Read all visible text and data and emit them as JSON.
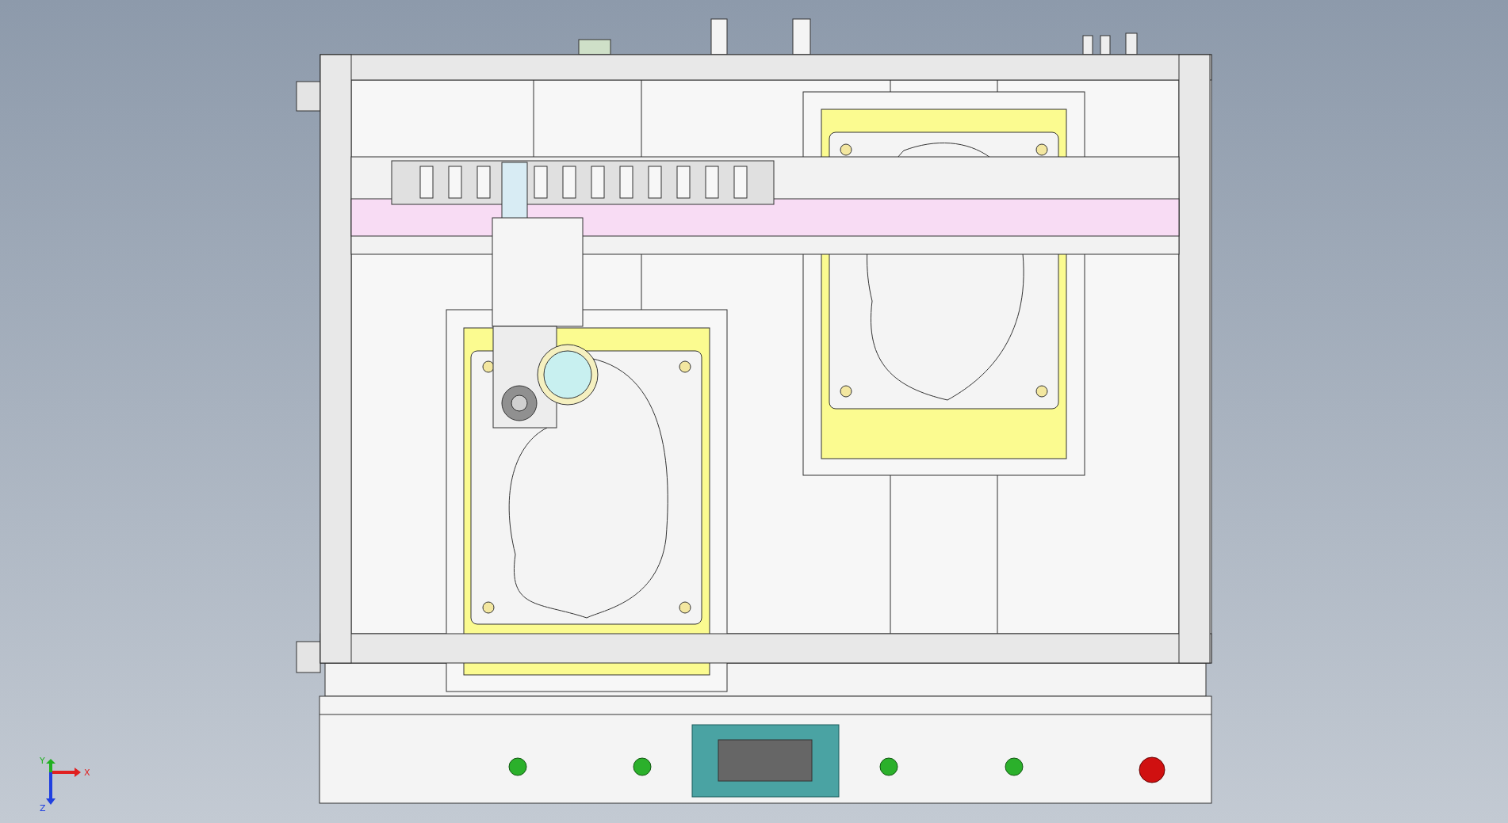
{
  "viewport": {
    "triad": {
      "axes": [
        {
          "label": "X",
          "kind": "right",
          "color": "#e02020"
        },
        {
          "label": "Y",
          "kind": "up",
          "color": "#20b020"
        },
        {
          "label": "Z",
          "kind": "down",
          "color": "#2040e0"
        }
      ]
    }
  }
}
